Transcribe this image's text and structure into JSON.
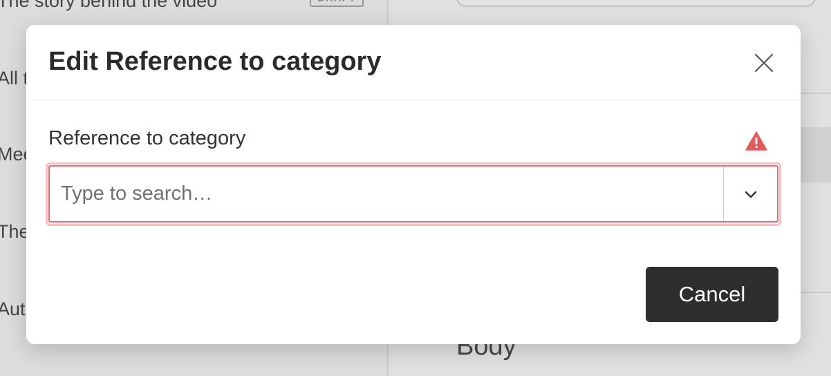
{
  "background": {
    "list_items": [
      {
        "title": "The story behind the video",
        "badge": "DRAFT"
      },
      {
        "title": "All t"
      },
      {
        "title": "Mee"
      },
      {
        "title": "The"
      },
      {
        "title": "Autu"
      }
    ],
    "body_label": "Body"
  },
  "dialog": {
    "title": "Edit Reference to category",
    "close_icon": "close-icon",
    "field": {
      "label": "Reference to category",
      "status_icon": "warning-icon",
      "input_placeholder": "Type to search…",
      "input_value": "",
      "toggle_icon": "chevron-down-icon"
    },
    "cancel_label": "Cancel"
  },
  "colors": {
    "error_border": "#e36a70",
    "error_ring": "#f5c2c4",
    "warning": "#e05c5c",
    "primary_button": "#2e2e2e"
  }
}
